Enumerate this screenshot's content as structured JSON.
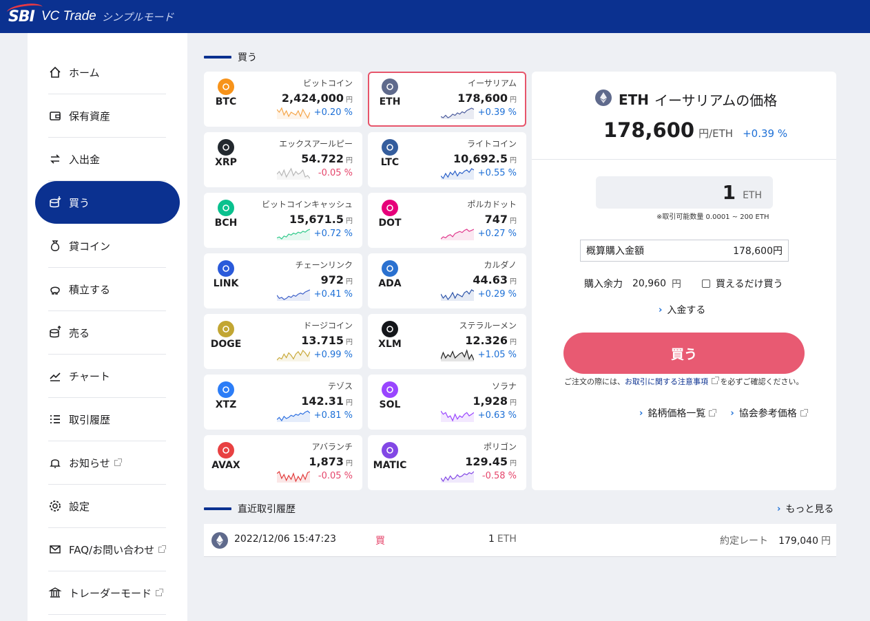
{
  "header": {
    "brand": "SBI",
    "product": "VC Trade",
    "mode": "シンプルモード"
  },
  "sidebar": {
    "items": [
      {
        "label": "ホーム",
        "icon": "home-icon"
      },
      {
        "label": "保有資産",
        "icon": "wallet-icon"
      },
      {
        "label": "入出金",
        "icon": "transfer-icon"
      },
      {
        "label": "買う",
        "icon": "buy-coins-icon"
      },
      {
        "label": "貸コイン",
        "icon": "moneybag-icon"
      },
      {
        "label": "積立する",
        "icon": "piggy-bank-icon"
      },
      {
        "label": "売る",
        "icon": "sell-coins-icon"
      },
      {
        "label": "チャート",
        "icon": "chart-line-icon"
      },
      {
        "label": "取引履歴",
        "icon": "list-icon"
      },
      {
        "label": "お知らせ",
        "icon": "bell-icon"
      },
      {
        "label": "設定",
        "icon": "gear-icon"
      },
      {
        "label": "FAQ/お問い合わせ",
        "icon": "mail-icon"
      },
      {
        "label": "トレーダーモード",
        "icon": "bank-icon"
      }
    ],
    "active": "買う"
  },
  "buy_section": {
    "title": "買う"
  },
  "coins": [
    {
      "sym": "BTC",
      "name": "ビットコイン",
      "price": "2,424,000",
      "change": "+0.20 %",
      "dir": "up",
      "color": "#f7931a",
      "line": "#f5a64a"
    },
    {
      "sym": "ETH",
      "name": "イーサリアム",
      "price": "178,600",
      "change": "+0.39 %",
      "dir": "up",
      "color": "#5f6a8c",
      "line": "#4a5a9c"
    },
    {
      "sym": "XRP",
      "name": "エックスアールピー",
      "price": "54.722",
      "change": "-0.05 %",
      "dir": "down",
      "color": "#23292f",
      "line": "#b8b8b8"
    },
    {
      "sym": "LTC",
      "name": "ライトコイン",
      "price": "10,692.5",
      "change": "+0.55 %",
      "dir": "up",
      "color": "#345d9d",
      "line": "#2a60c8"
    },
    {
      "sym": "BCH",
      "name": "ビットコインキャッシュ",
      "price": "15,671.5",
      "change": "+0.72 %",
      "dir": "up",
      "color": "#0ac18e",
      "line": "#2fc98a"
    },
    {
      "sym": "DOT",
      "name": "ポルカドット",
      "price": "747",
      "change": "+0.27 %",
      "dir": "up",
      "color": "#e6007a",
      "line": "#e0378c"
    },
    {
      "sym": "LINK",
      "name": "チェーンリンク",
      "price": "972",
      "change": "+0.41 %",
      "dir": "up",
      "color": "#2a5ada",
      "line": "#3a5ec8"
    },
    {
      "sym": "ADA",
      "name": "カルダノ",
      "price": "44.63",
      "change": "+0.29 %",
      "dir": "up",
      "color": "#2a71d0",
      "line": "#2a52a8"
    },
    {
      "sym": "DOGE",
      "name": "ドージコイン",
      "price": "13.715",
      "change": "+0.99 %",
      "dir": "up",
      "color": "#c2a633",
      "line": "#c9a93a"
    },
    {
      "sym": "XLM",
      "name": "ステラルーメン",
      "price": "12.326",
      "change": "+1.05 %",
      "dir": "up",
      "color": "#14161a",
      "line": "#222222"
    },
    {
      "sym": "XTZ",
      "name": "テゾス",
      "price": "142.31",
      "change": "+0.81 %",
      "dir": "up",
      "color": "#2c7df7",
      "line": "#2c6fe0"
    },
    {
      "sym": "SOL",
      "name": "ソラナ",
      "price": "1,928",
      "change": "+0.63 %",
      "dir": "up",
      "color": "#9945ff",
      "line": "#9945ff"
    },
    {
      "sym": "AVAX",
      "name": "アバランチ",
      "price": "1,873",
      "change": "-0.05 %",
      "dir": "down",
      "color": "#e84142",
      "line": "#e23b3b"
    },
    {
      "sym": "MATIC",
      "name": "ポリゴン",
      "price": "129.45",
      "change": "-0.58 %",
      "dir": "down",
      "color": "#8247e5",
      "line": "#8247e5"
    }
  ],
  "yen_unit": "円",
  "detail": {
    "sym": "ETH",
    "title": "イーサリアムの価格",
    "price": "178,600",
    "unit": "円/ETH",
    "change": "+0.39 %",
    "quantity": "1",
    "quantity_unit": "ETH",
    "qty_note": "※取引可能数量 0.0001 ~ 200 ETH",
    "amount_label": "概算購入金額",
    "amount_value": "178,600円",
    "balance_label": "購入余力",
    "balance_value": "20,960",
    "balance_unit": "円",
    "buy_max_label": "買えるだけ買う",
    "deposit_label": "入金する",
    "buy_button": "買う",
    "notice_pre": "ご注文の際には、",
    "notice_link": "お取引に関する注意事項",
    "notice_post": "を必ずご確認ください。",
    "link_prices": "銘柄価格一覧",
    "link_assoc": "協会参考価格"
  },
  "history": {
    "title": "直近取引履歴",
    "more": "もっと見る",
    "rows": [
      {
        "datetime": "2022/12/06 15:47:23",
        "side": "買",
        "qty": "1",
        "unit": "ETH",
        "rate_label": "約定レート",
        "rate": "179,040",
        "rate_unit": "円"
      }
    ]
  }
}
